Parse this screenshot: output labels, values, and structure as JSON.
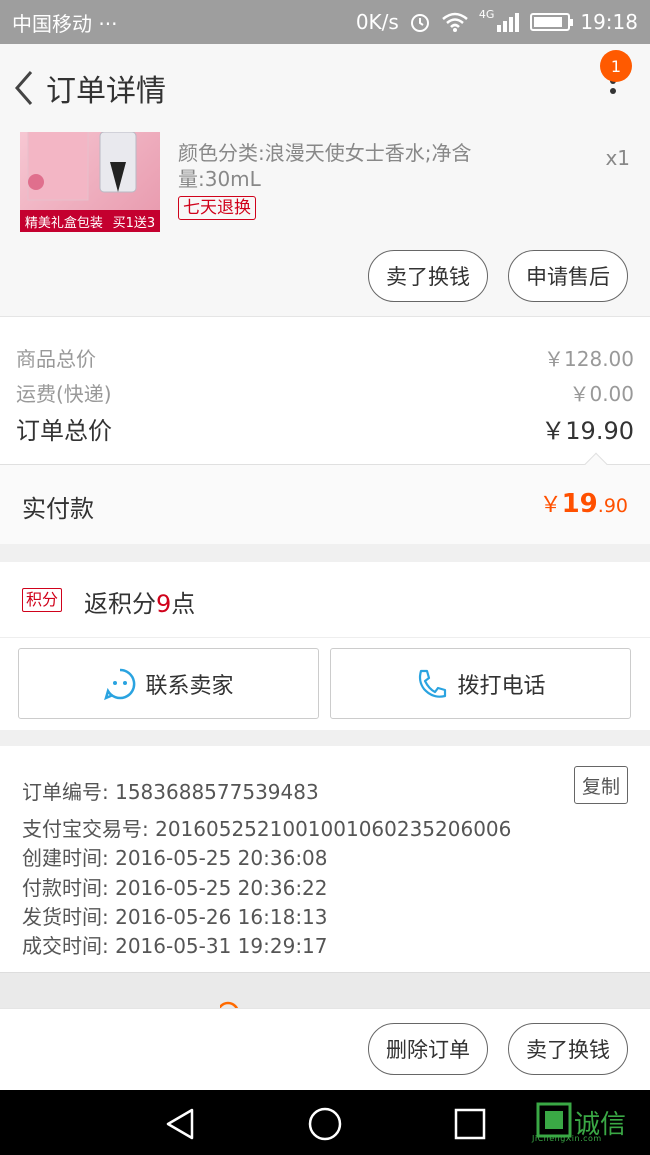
{
  "status_bar": {
    "carrier": "中国移动",
    "dots": "···",
    "speed": "0K/s",
    "network": "4G",
    "time": "19:18"
  },
  "header": {
    "title": "订单详情",
    "badge_count": "1"
  },
  "product": {
    "spec": "颜色分类:浪漫天使女士香水;净含量:30mL",
    "quantity": "x1",
    "thumb_tag_left": "精美礼盒包装",
    "thumb_tag_right": "买1送3",
    "refund_tag": "七天退换",
    "actions": {
      "sell_label": "卖了换钱",
      "after_sale_label": "申请售后"
    }
  },
  "summary": {
    "goods_label": "商品总价",
    "goods_value": "￥128.00",
    "shipping_label": "运费(快递)",
    "shipping_value": "￥0.00",
    "total_label": "订单总价",
    "total_value": "￥19.90"
  },
  "paid": {
    "label": "实付款",
    "currency": "￥",
    "integer": "19",
    "decimal": ".90"
  },
  "points": {
    "tag": "积分",
    "prefix": "返积分",
    "value": "9",
    "suffix": "点"
  },
  "contact": {
    "seller_label": "联系卖家",
    "call_label": "拨打电话"
  },
  "order_info": {
    "copy_label": "复制",
    "lines": [
      "订单编号: 1583688577539483",
      "支付宝交易号: 2016052521001001060235206006",
      "创建时间: 2016-05-25 20:36:08",
      "付款时间: 2016-05-25 20:36:22",
      "发货时间: 2016-05-26 16:18:13",
      "成交时间: 2016-05-31 19:29:17"
    ]
  },
  "bottom_bar": {
    "delete_label": "删除订单",
    "sell_label": "卖了换钱"
  },
  "watermark": {
    "text": "诚信",
    "sub": "JiChengXin.com"
  },
  "colors": {
    "accent": "#ff5000",
    "red_tag": "#d0021b",
    "contact_blue": "#2aa3e0"
  }
}
